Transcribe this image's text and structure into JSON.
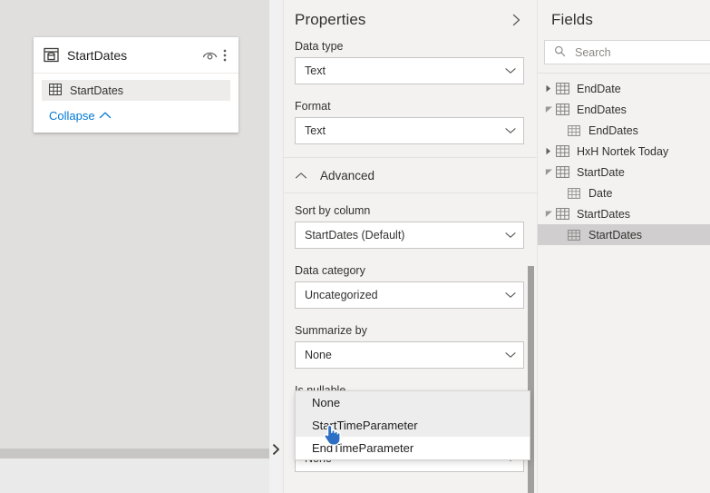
{
  "canvas": {
    "table_card": {
      "title": "StartDates",
      "header_icons": {
        "table_icon": "table-card-icon",
        "hide_icon": "hidden-eye-icon",
        "more_icon": "more-options-icon"
      },
      "fields": [
        {
          "label": "StartDates",
          "icon": "grid-icon",
          "selected": true
        }
      ],
      "collapse_label": "Collapse"
    },
    "expand_button_icon": "chevron-right-icon"
  },
  "properties": {
    "title": "Properties",
    "collapse_icon": "chevron-right-icon",
    "groups": [
      {
        "label": "Data type",
        "value": "Text"
      },
      {
        "label": "Format",
        "value": "Text"
      }
    ],
    "advanced": {
      "label": "Advanced",
      "chevron_icon": "chevron-up-icon",
      "groups": [
        {
          "label": "Sort by column",
          "value": "StartDates (Default)"
        },
        {
          "label": "Data category",
          "value": "Uncategorized"
        },
        {
          "label": "Summarize by",
          "value": "None"
        },
        {
          "label": "Is nullable",
          "value": "None"
        }
      ]
    },
    "dropdown": {
      "open": true,
      "options": [
        {
          "label": "None",
          "highlighted": true
        },
        {
          "label": "StartTimeParameter",
          "highlighted": true
        },
        {
          "label": "EndTimeParameter",
          "highlighted": false
        }
      ]
    },
    "cursor_icon": "hand-pointer-cursor"
  },
  "fields": {
    "title": "Fields",
    "search": {
      "placeholder": "Search",
      "value": "",
      "icon": "search-icon"
    },
    "tree": [
      {
        "name": "EndDate",
        "level": 0,
        "expanded": false,
        "icon": "table-icon",
        "selected": false
      },
      {
        "name": "EndDates",
        "level": 0,
        "expanded": true,
        "icon": "table-icon",
        "selected": false
      },
      {
        "name": "EndDates",
        "level": 1,
        "expanded": null,
        "icon": "column-icon",
        "selected": false
      },
      {
        "name": "HxH Nortek Today",
        "level": 0,
        "expanded": false,
        "icon": "table-icon",
        "selected": false
      },
      {
        "name": "StartDate",
        "level": 0,
        "expanded": true,
        "icon": "table-icon",
        "selected": false
      },
      {
        "name": "Date",
        "level": 1,
        "expanded": null,
        "icon": "column-icon",
        "selected": false
      },
      {
        "name": "StartDates",
        "level": 0,
        "expanded": true,
        "icon": "table-icon",
        "selected": false
      },
      {
        "name": "StartDates",
        "level": 1,
        "expanded": null,
        "icon": "column-icon",
        "selected": true
      }
    ]
  },
  "colors": {
    "canvas_bg": "#e1dfdd",
    "pane_bg": "#f3f2f1",
    "accent_link": "#0078d4",
    "selection_bg": "#d0cece",
    "scroll_thumb": "#a19f9d",
    "border": "#c8c6c4"
  }
}
